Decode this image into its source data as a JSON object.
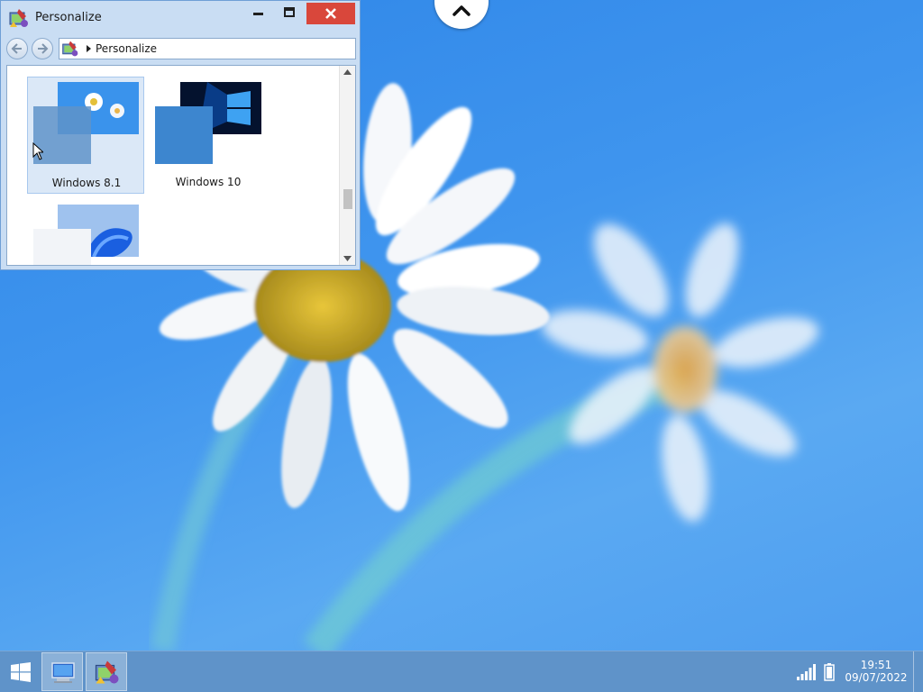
{
  "window": {
    "title": "Personalize",
    "address_path": "Personalize",
    "controls": {
      "minimize": "minimize",
      "maximize": "maximize",
      "close": "close"
    }
  },
  "themes": [
    {
      "label": "Windows 8.1",
      "selected": true
    },
    {
      "label": "Windows 10",
      "selected": false
    },
    {
      "label": "",
      "selected": false
    }
  ],
  "taskbar": {
    "time": "19:51",
    "date": "09/07/2022",
    "pinned": [
      "explorer",
      "personalize"
    ]
  },
  "colors": {
    "desktop_bg": "#3f95ee",
    "taskbar_bg": "#5f93c9",
    "window_frame": "#c9ddf3",
    "close_button": "#d9473b",
    "selection_bg": "#dbe8f7"
  },
  "icons": {
    "start": "windows-logo-icon",
    "signal": "signal-bars-icon",
    "battery": "battery-icon",
    "chevron": "chevron-up-icon"
  }
}
